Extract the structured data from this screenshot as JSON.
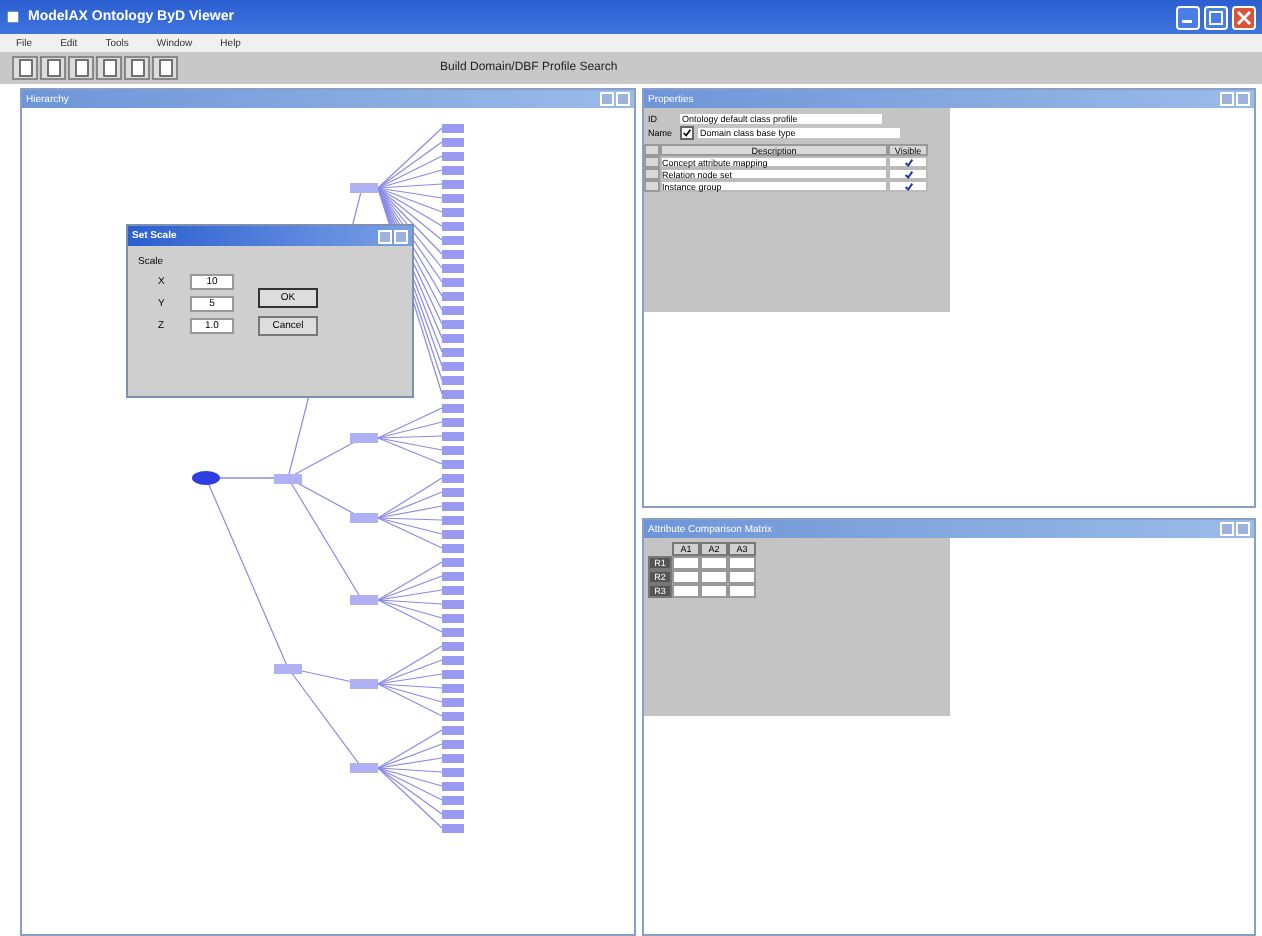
{
  "window": {
    "title": "ModelAX Ontology ByD Viewer"
  },
  "menu": [
    "File",
    "Edit",
    "Tools",
    "Window",
    "Help"
  ],
  "toolbar": {
    "caption": "Build Domain/DBF Profile Search"
  },
  "tree_panel": {
    "title": "Hierarchy"
  },
  "dialog": {
    "title": "Set Scale",
    "group_label": "Scale",
    "fields": [
      {
        "label": "X",
        "value": "10"
      },
      {
        "label": "Y",
        "value": "5"
      },
      {
        "label": "Z",
        "value": "1.0"
      }
    ],
    "buttons": [
      "OK",
      "Cancel"
    ]
  },
  "properties_panel": {
    "title": "Properties",
    "fields": [
      {
        "label": "ID",
        "kind": "text",
        "value": "Ontology default class profile"
      },
      {
        "label": "Name",
        "kind": "check",
        "checked": true,
        "value": "Domain class base type"
      }
    ],
    "columns": [
      "Description",
      "Visible"
    ],
    "rows": [
      {
        "text": "Concept attribute mapping",
        "checked": true
      },
      {
        "text": "Relation node set",
        "checked": true
      },
      {
        "text": "Instance group",
        "checked": true
      }
    ]
  },
  "matrix_panel": {
    "title": "Attribute Comparison Matrix",
    "columns": [
      "A1",
      "A2",
      "A3"
    ],
    "rows": [
      "R1",
      "R2",
      "R3"
    ]
  }
}
